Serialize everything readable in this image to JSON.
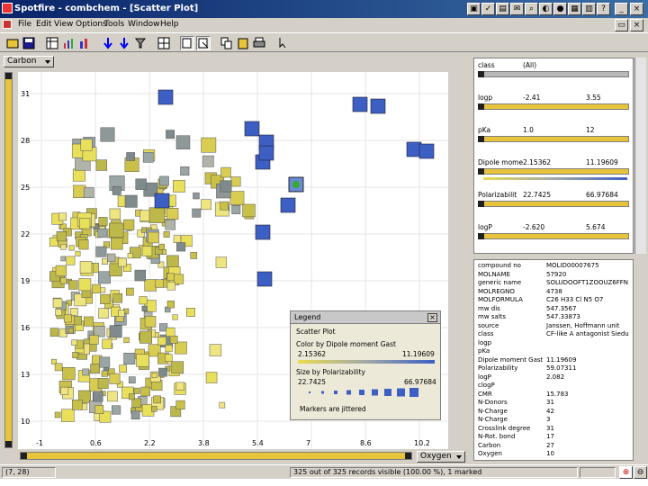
{
  "window": {
    "title": "Spotfire - combchem - [Scatter Plot]"
  },
  "menu": [
    "File",
    "Edit",
    "View",
    "Options",
    "Tools",
    "Window",
    "Help"
  ],
  "plot": {
    "y_axis_combo": "Carbon",
    "x_axis_combo": "Oxygen",
    "y_ticks": [
      "31",
      "28",
      "25",
      "22",
      "19",
      "16",
      "13",
      "10"
    ],
    "x_ticks": [
      "-1",
      "0.6",
      "2.2",
      "3.8",
      "5.4",
      "7",
      "8.6",
      "10.2"
    ]
  },
  "legend": {
    "title": "Legend",
    "close": "×",
    "plot_name": "Scatter Plot",
    "color_by": "Color by Dipole moment Gast",
    "color_min": "2.15362",
    "color_max": "11.19609",
    "size_by": "Size by Polarizability",
    "size_min": "22.7425",
    "size_max": "66.97684",
    "jitter_note": "Markers are jittered"
  },
  "query_devices": [
    {
      "name": "class",
      "v1": "(All)",
      "v2": "",
      "style": "gray"
    },
    {
      "name": "logp",
      "v1": "-2.41",
      "v2": "3.55",
      "style": "yellow"
    },
    {
      "name": "pKa",
      "v1": "1.0",
      "v2": "12",
      "style": "yellow"
    },
    {
      "name": "Dipole mome",
      "v1": "2.15362",
      "v2": "11.19609",
      "style": "yellow"
    },
    {
      "name": "Polarizabilit",
      "v1": "22.7425",
      "v2": "66.97684",
      "style": "yellow"
    },
    {
      "name": "logP",
      "v1": "-2.620",
      "v2": "5.674",
      "style": "yellow"
    }
  ],
  "details": [
    {
      "k": "compound no",
      "v": "MOLID00007675"
    },
    {
      "k": "MOLNAME",
      "v": "57920"
    },
    {
      "k": "generic name",
      "v": "SOLUDOOFT1ZOOUZ6FFN"
    },
    {
      "k": "MOLREGNO",
      "v": "4738"
    },
    {
      "k": "MOLFORMULA",
      "v": "C26 H33 Cl N5 O7"
    },
    {
      "k": "mw dis",
      "v": "547.3567"
    },
    {
      "k": "mw salts",
      "v": "547.33873"
    },
    {
      "k": "source",
      "v": "Janssen, Hoffmann unit"
    },
    {
      "k": "class",
      "v": "CF-like A antagonist Siedu"
    },
    {
      "k": "logp",
      "v": ""
    },
    {
      "k": "pKa",
      "v": ""
    },
    {
      "k": "Dipole moment Gast",
      "v": "11.19609"
    },
    {
      "k": "Polarizability",
      "v": "59.07311"
    },
    {
      "k": "logP",
      "v": "2.082"
    },
    {
      "k": "clogP",
      "v": ""
    },
    {
      "k": "CMR",
      "v": "15.783"
    },
    {
      "k": "N-Donors",
      "v": "31"
    },
    {
      "k": "N-Charge",
      "v": "42"
    },
    {
      "k": "N-Charge",
      "v": "3"
    },
    {
      "k": "Crosslink degree",
      "v": "31"
    },
    {
      "k": "N-Rot. bond",
      "v": "17"
    },
    {
      "k": "Carbon",
      "v": "27"
    },
    {
      "k": "Oxygen",
      "v": "10"
    }
  ],
  "status": {
    "coords": "(7, 28)",
    "records": "325 out of 325 records visible (100.00 %), 1 marked"
  },
  "colors": {
    "accent": "#e8c43a",
    "high": "#3d5fc4",
    "mid": "#9aa5a5",
    "low": "#d9cc52"
  }
}
